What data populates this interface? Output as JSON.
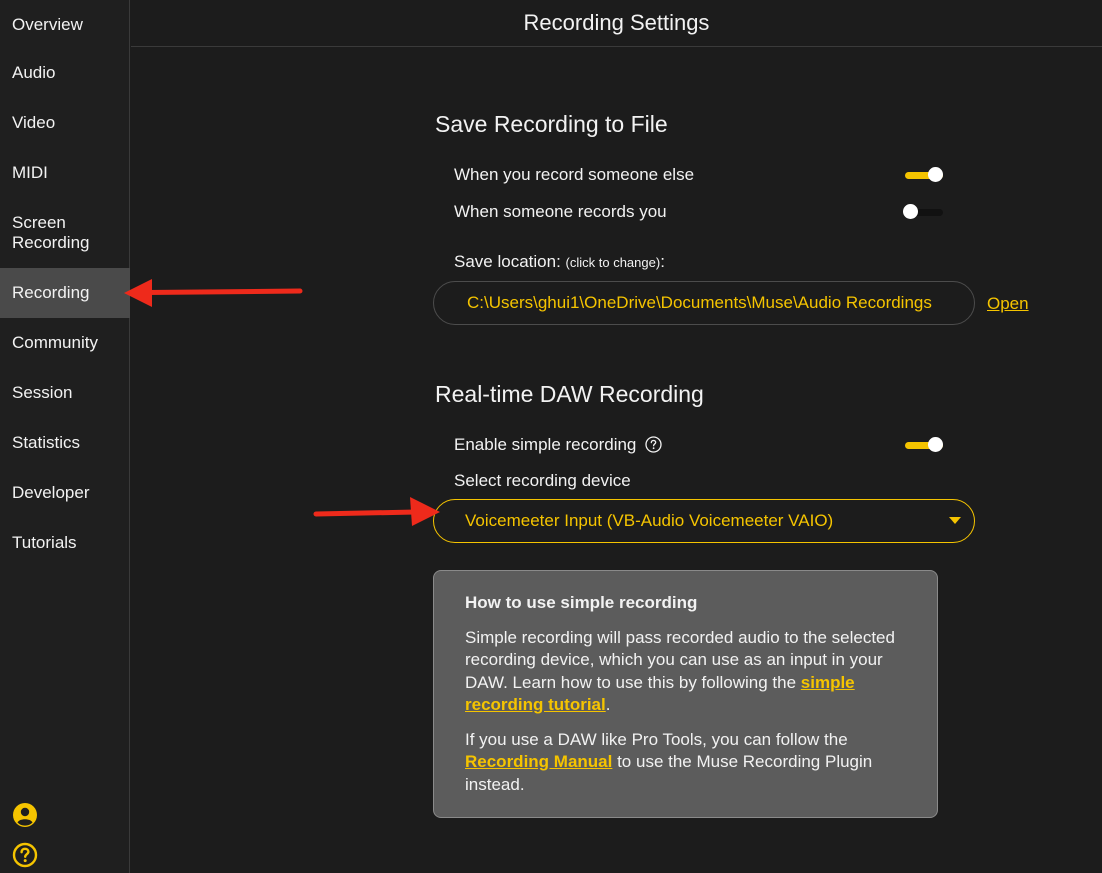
{
  "header": {
    "title": "Recording Settings"
  },
  "sidebar": {
    "items": [
      {
        "label": "Overview"
      },
      {
        "label": "Audio"
      },
      {
        "label": "Video"
      },
      {
        "label": "MIDI"
      },
      {
        "label": "Screen Recording"
      },
      {
        "label": "Recording",
        "active": true
      },
      {
        "label": "Community"
      },
      {
        "label": "Session"
      },
      {
        "label": "Statistics"
      },
      {
        "label": "Developer"
      },
      {
        "label": "Tutorials"
      }
    ],
    "bottom_icons": [
      "account-icon",
      "help-icon"
    ]
  },
  "save_section": {
    "title": "Save Recording to File",
    "toggle_record_else": {
      "label": "When you record someone else",
      "on": true
    },
    "toggle_someone_records": {
      "label": "When someone records you",
      "on": false
    },
    "location_label": "Save location:",
    "location_hint": "(click to change)",
    "location_colon": ":",
    "path": "C:\\Users\\ghui1\\OneDrive\\Documents\\Muse\\Audio Recordings",
    "open_label": "Open"
  },
  "daw_section": {
    "title": "Real-time DAW Recording",
    "toggle_simple": {
      "label": "Enable simple recording",
      "on": true
    },
    "device_label": "Select recording device",
    "device_selected": "Voicemeeter Input (VB-Audio Voicemeeter VAIO)"
  },
  "help_box": {
    "heading": "How to use simple recording",
    "p1_text": "Simple recording will pass recorded audio to the selected recording device, which you can use as an input in your DAW. Learn how to use this by following the ",
    "p1_link": "simple recording tutorial",
    "p1_end": ".",
    "p2_text": "If you use a DAW like Pro Tools, you can follow the ",
    "p2_link": "Recording Manual",
    "p2_end": " to use the Muse Recording Plugin instead."
  },
  "colors": {
    "accent": "#f5c400",
    "annotation_arrow": "#ee2a1b",
    "background": "#1c1c1c",
    "sidebar_active": "#4a4a4a"
  }
}
